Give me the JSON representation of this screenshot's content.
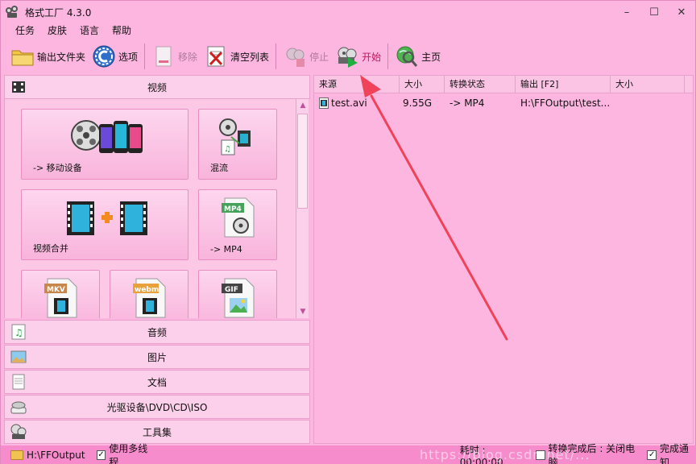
{
  "window": {
    "title": "格式工厂 4.3.0",
    "controls": {
      "minimize": "–",
      "maximize": "☐",
      "close": "✕"
    }
  },
  "menu": [
    "任务",
    "皮肤",
    "语言",
    "帮助"
  ],
  "toolbar": {
    "output_folder": "输出文件夹",
    "options": "选项",
    "remove": "移除",
    "clear_list": "清空列表",
    "stop": "停止",
    "start": "开始",
    "home": "主页"
  },
  "categories": {
    "video": "视频",
    "audio": "音频",
    "picture": "图片",
    "document": "文档",
    "rom": "光驱设备\\DVD\\CD\\ISO",
    "tools": "工具集"
  },
  "tiles": {
    "mobile": "-> 移动设备",
    "mux": "混流",
    "join": "视频合并",
    "mp4": "-> MP4",
    "mkv_badge": "MKV",
    "webm_badge": "webm",
    "gif_badge": "GIF",
    "mp4_badge": "MP4"
  },
  "table": {
    "headers": [
      "来源",
      "大小",
      "转换状态",
      "输出 [F2]",
      "大小"
    ],
    "rows": [
      {
        "source": "test.avi",
        "size": "9.55G",
        "status": "-> MP4",
        "output": "H:\\FFOutput\\test...",
        "out_size": ""
      }
    ]
  },
  "statusbar": {
    "output_path": "H:\\FFOutput",
    "multithread": "使用多线程",
    "multithread_checked": true,
    "elapsed": "耗时 : 00:00:00",
    "shutdown_after": "转换完成后 : 关闭电脑",
    "shutdown_checked": false,
    "notify": "完成通知",
    "notify_checked": true
  },
  "watermark": "https://blog.csdn.net/...",
  "colors": {
    "background": "#fdb6e0",
    "statusbar": "#f78ccc",
    "arrow": "#f0435a"
  }
}
